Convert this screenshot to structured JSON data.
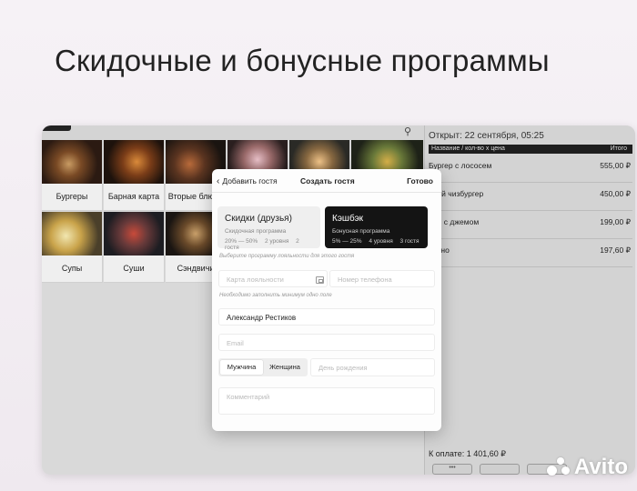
{
  "headline": "Скидочные и бонусные программы",
  "menu": {
    "tiles": [
      {
        "label": "Бургеры"
      },
      {
        "label": "Барная карта"
      },
      {
        "label": "Вторые блюда"
      },
      {
        "label": ""
      },
      {
        "label": ""
      },
      {
        "label": ""
      },
      {
        "label": "Супы"
      },
      {
        "label": "Суши"
      },
      {
        "label": "Сэндвичи"
      }
    ]
  },
  "order": {
    "opened": "Открыт: 22 сентября, 05:25",
    "col_name": "Название / кол-во x цена",
    "col_total": "Итого",
    "items": [
      {
        "name": "Бургер с лососем",
        "price": "555,00 ₽"
      },
      {
        "name": "йной чизбургер",
        "price": "450,00 ₽"
      },
      {
        "name": "али с джемом",
        "price": "199,00 ₽"
      },
      {
        "name": "учино",
        "price": "197,60 ₽"
      }
    ],
    "total": "К оплате: 1 401,60 ₽"
  },
  "modal": {
    "back_label": "Добавить гостя",
    "title": "Создать гостя",
    "done_label": "Готово",
    "programs": [
      {
        "title": "Скидки (друзья)",
        "subtitle": "Скидочная программа",
        "range": "20% — 50%",
        "levels": "2 уровня",
        "guests": "2 гостя"
      },
      {
        "title": "Кэшбэк",
        "subtitle": "Бонусная программа",
        "range": "5% — 25%",
        "levels": "4 уровня",
        "guests": "3 гостя"
      }
    ],
    "program_hint": "Выберите программу лояльности для этого гостя",
    "card_placeholder": "Карта лояльности",
    "phone_placeholder": "Номер телефона",
    "required_hint": "Необходимо заполнить минимум одно поле",
    "name_value": "Александр Рестиков",
    "email_placeholder": "Email",
    "gender_male": "Мужчина",
    "gender_female": "Женщина",
    "birthday_placeholder": "День рождения",
    "comment_placeholder": "Комментарий"
  },
  "watermark": "Avito"
}
